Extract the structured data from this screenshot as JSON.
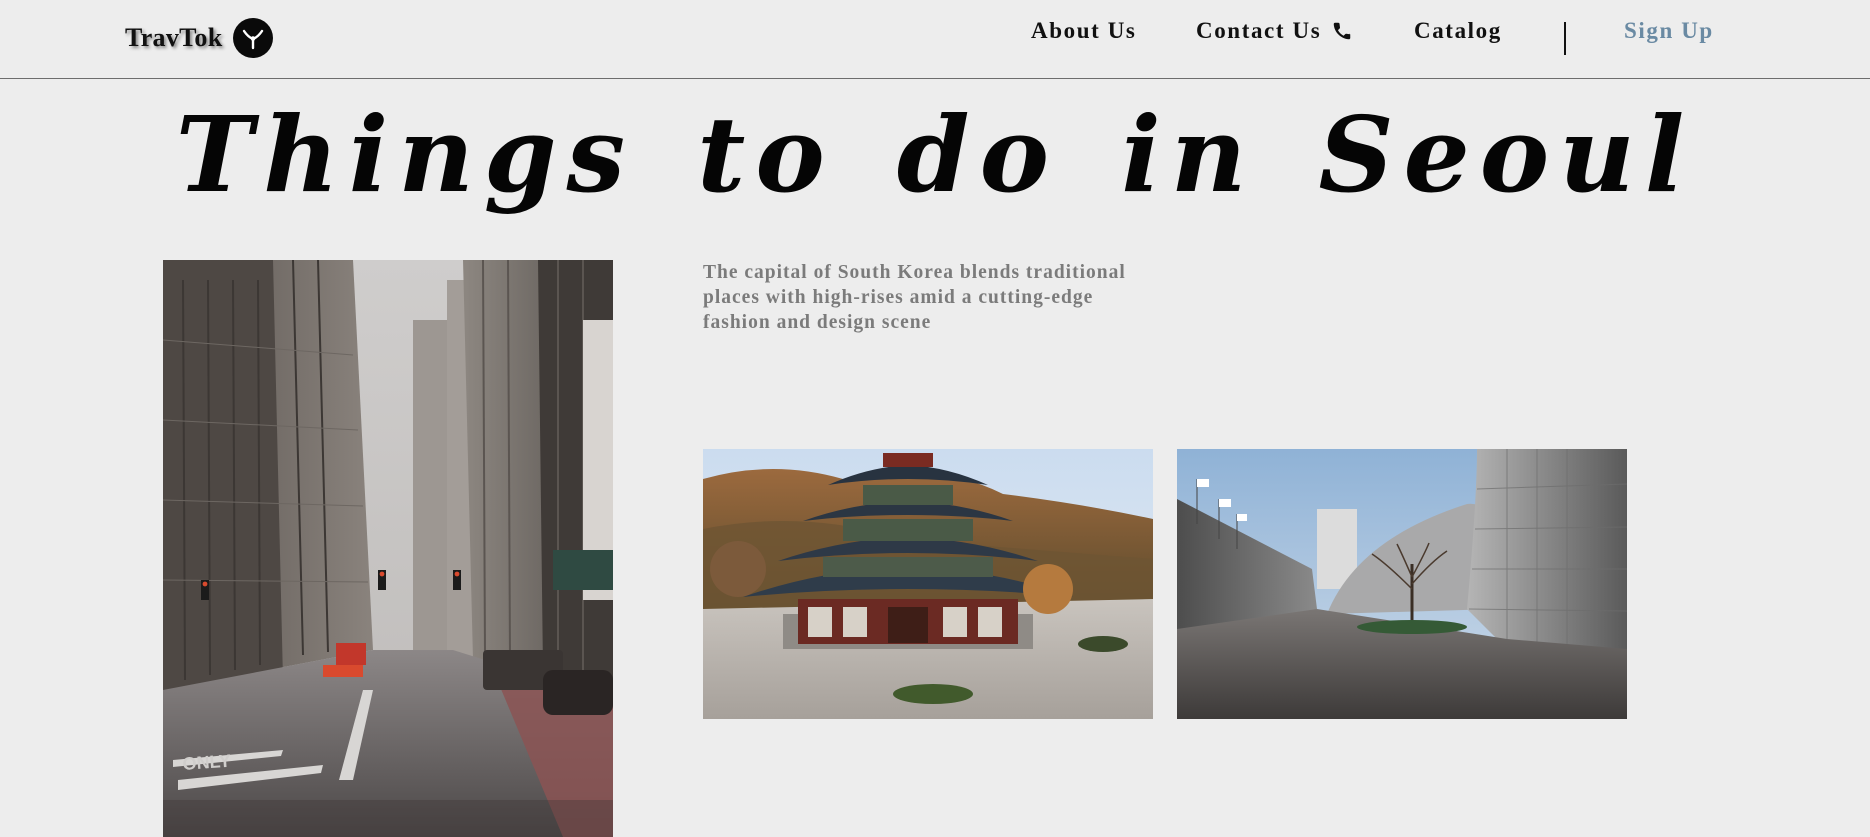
{
  "header": {
    "logo_text": "TravTok",
    "logo_icon": "plane-icon",
    "nav": {
      "about": "About Us",
      "contact": "Contact Us",
      "catalog": "Catalog",
      "signup": "Sign Up"
    },
    "contact_icon": "phone-icon"
  },
  "hero": {
    "title": "Things to do in Seoul",
    "description": "The capital of South Korea blends traditional places with high-rises amid a cutting-edge fashion and design scene"
  },
  "colors": {
    "background": "#ededed",
    "signup_accent": "#6a8aa3",
    "description_text": "#7b7b7b"
  }
}
